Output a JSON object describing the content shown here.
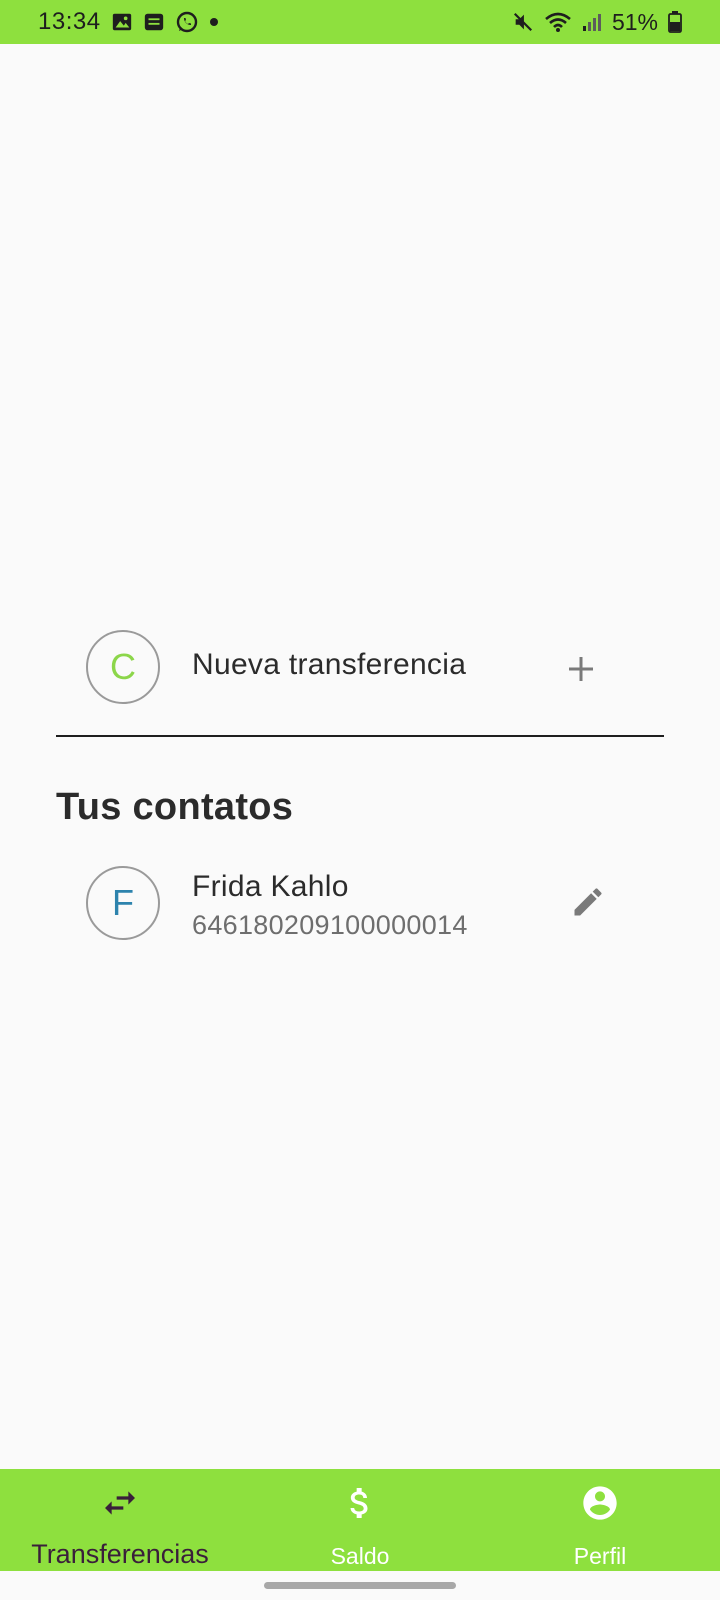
{
  "status_bar": {
    "time": "13:34",
    "battery": "51%",
    "background": "#8ee03e",
    "left_icons": [
      "image-icon",
      "message-icon",
      "whatsapp-icon",
      "dot-icon"
    ],
    "right_icons": [
      "mute-icon",
      "wifi-icon",
      "signal-icon",
      "battery-icon"
    ]
  },
  "new_transfer": {
    "avatar_letter": "C",
    "label": "Nueva transferencia",
    "action_icon": "plus-icon"
  },
  "contacts": {
    "title": "Tus contatos",
    "items": [
      {
        "avatar_letter": "F",
        "name": "Frida Kahlo",
        "account": "646180209100000014",
        "action_icon": "edit-icon"
      }
    ]
  },
  "bottom_nav": {
    "background": "#8ee03e",
    "items": [
      {
        "label": "Transferencias",
        "icon": "transfer-arrows-icon",
        "active": true,
        "color": "#3a1f3a"
      },
      {
        "label": "Saldo",
        "icon": "dollar-icon",
        "active": false,
        "color": "#ffffff"
      },
      {
        "label": "Perfil",
        "icon": "account-circle-icon",
        "active": false,
        "color": "#ffffff"
      }
    ]
  }
}
